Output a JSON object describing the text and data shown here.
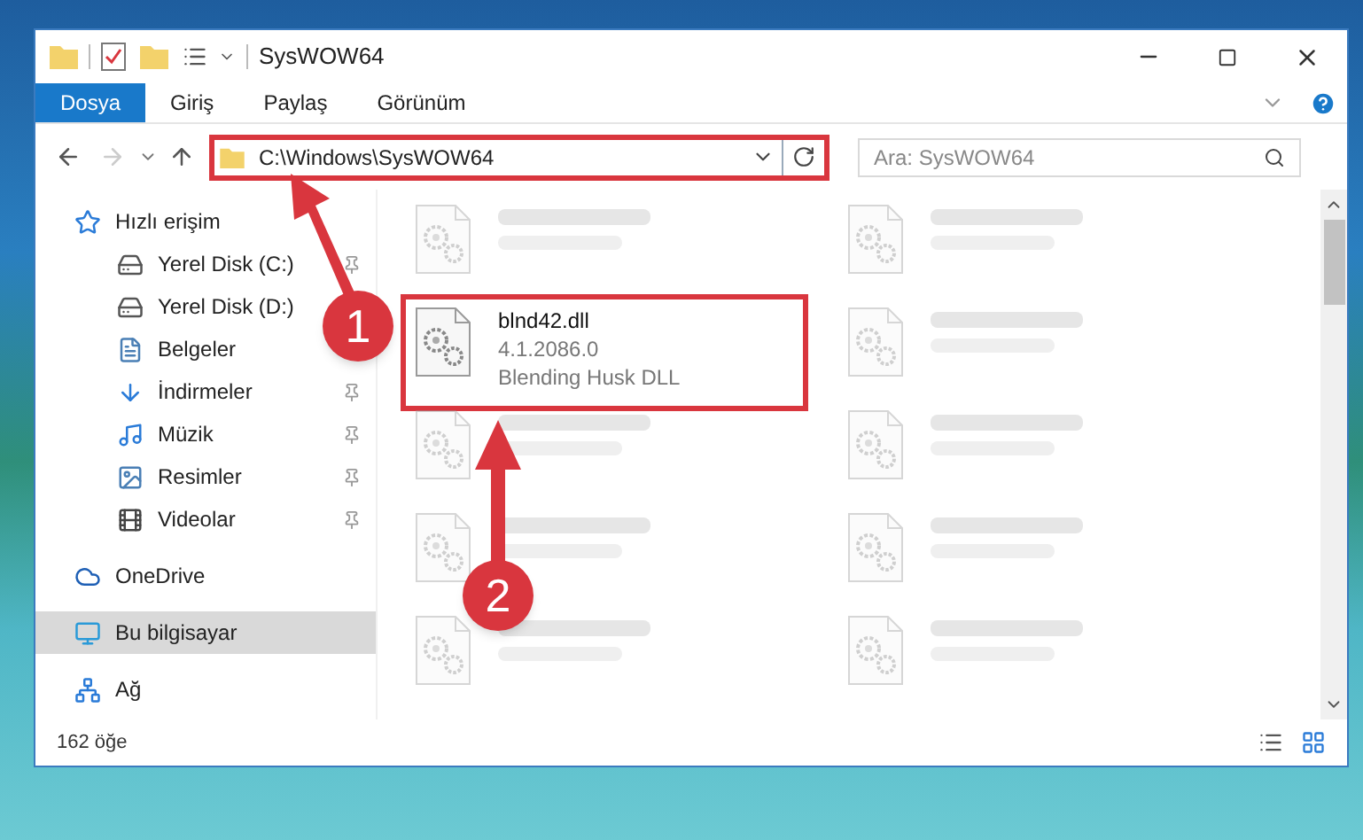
{
  "window": {
    "title": "SysWOW64"
  },
  "ribbon_tabs": [
    {
      "label": "Dosya",
      "selected": true
    },
    {
      "label": "Giriş",
      "selected": false
    },
    {
      "label": "Paylaş",
      "selected": false
    },
    {
      "label": "Görünüm",
      "selected": false
    }
  ],
  "address_bar": {
    "path": "C:\\Windows\\SysWOW64"
  },
  "search": {
    "placeholder": "Ara: SysWOW64"
  },
  "sidebar": {
    "items": [
      {
        "label": "Hızlı erişim",
        "kind": "star",
        "selected": false,
        "pinned": false,
        "children": [
          {
            "label": "Yerel Disk (C:)",
            "kind": "drive-c",
            "selected": false,
            "pinned": true
          },
          {
            "label": "Yerel Disk (D:)",
            "kind": "drive",
            "selected": false
          },
          {
            "label": "Belgeler",
            "kind": "docs",
            "selected": false
          },
          {
            "label": "İndirmeler",
            "kind": "download",
            "selected": false,
            "pinned": true
          },
          {
            "label": "Müzik",
            "kind": "music",
            "selected": false,
            "pinned": true
          },
          {
            "label": "Resimler",
            "kind": "pictures",
            "selected": false,
            "pinned": true
          },
          {
            "label": "Videolar",
            "kind": "video",
            "selected": false,
            "pinned": true
          }
        ]
      },
      {
        "label": "OneDrive",
        "kind": "cloud",
        "selected": false,
        "pinned": false
      },
      {
        "label": "Bu bilgisayar",
        "kind": "pc",
        "selected": true,
        "pinned": false
      },
      {
        "label": "Ağ",
        "kind": "network",
        "selected": false,
        "pinned": false
      }
    ]
  },
  "files": [
    {
      "kind": "blurred"
    },
    {
      "kind": "blurred"
    },
    {
      "kind": "file",
      "name": "blnd42.dll",
      "version": "4.1.2086.0",
      "description": "Blending Husk DLL",
      "highlighted": true
    },
    {
      "kind": "blurred"
    },
    {
      "kind": "blurred"
    },
    {
      "kind": "blurred"
    },
    {
      "kind": "blurred"
    },
    {
      "kind": "blurred"
    },
    {
      "kind": "blurred"
    },
    {
      "kind": "blurred"
    }
  ],
  "status_bar": {
    "item_count": "162 öğe"
  },
  "annotations": [
    {
      "number": "1"
    },
    {
      "number": "2"
    }
  ]
}
